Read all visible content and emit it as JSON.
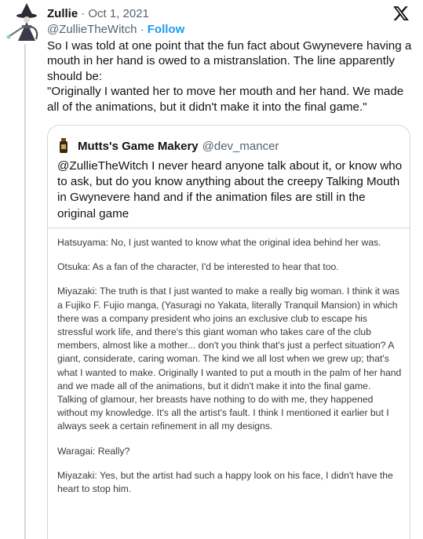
{
  "tweet": {
    "display_name": "Zullie",
    "date": "· Oct 1, 2021",
    "handle": "@ZullieTheWitch",
    "separator": " · ",
    "follow_label": "Follow",
    "body": [
      "So I was told at one point that the fun fact about Gwynevere having a mouth in her hand is owed to a mistranslation. The line apparently should be:",
      "\"Originally I wanted her to move her mouth and her hand. We made all of the animations, but it didn't make it into the final game.\""
    ]
  },
  "quote": {
    "display_name": "Mutts's Game Makery",
    "handle": "@dev_mancer",
    "text": "@ZullieTheWitch I never heard anyone talk about it, or know who to ask, but do you know anything about the creepy Talking Mouth in Gwynevere hand and if the animation files are still in the original game"
  },
  "image_text": [
    "Hatsuyama: No, I just wanted to know what the original idea behind her was.",
    "Otsuka: As a fan of the character, I'd be interested to hear that too.",
    "Miyazaki: The truth is that I just wanted to make a really big woman. I think it was a Fujiko F. Fujio manga, (Yasuragi no Yakata, literally Tranquil Mansion) in which there was a company president who joins an exclusive club to escape his stressful work life, and there's this giant woman who takes care of the club members, almost like a mother... don't you think that's just a perfect situation? A giant, considerate, caring woman. The kind we all lost when we grew up; that's what I wanted to make. Originally I wanted to put a mouth in the palm of her hand and we made all of the animations, but it didn't make it into the final game. Talking of glamour, her breasts have nothing to do with me, they happened without my knowledge. It's all the artist's fault. I think I mentioned it earlier but I always seek a certain refinement in all my designs.",
    "Waragai: Really?",
    "Miyazaki: Yes, but the artist had such a happy look on his face, I didn't have the heart to stop him."
  ],
  "icons": {
    "avatar": "witch-avatar-icon",
    "platform": "x-logo-icon",
    "quote_avatar": "bottle-avatar-icon"
  },
  "colors": {
    "link": "#1d9bf0",
    "muted": "#536471",
    "text": "#0f1419",
    "border": "#cfd9de"
  }
}
